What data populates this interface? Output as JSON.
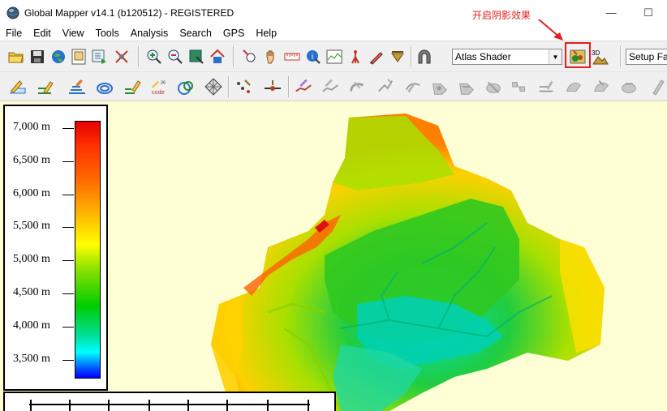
{
  "window": {
    "title": "Global Mapper v14.1 (b120512) - REGISTERED",
    "minimize": "—",
    "maximize": "☐"
  },
  "menu": [
    "File",
    "Edit",
    "View",
    "Tools",
    "Analysis",
    "Search",
    "GPS",
    "Help"
  ],
  "annotation": {
    "text": "开启阴影效果",
    "color": "#e02020"
  },
  "toolbar": {
    "shader": "Atlas Shader",
    "setup_favorites": "Setup Fav"
  },
  "legend": {
    "labels": [
      "7,000 m",
      "6,500 m",
      "6,000 m",
      "5,500 m",
      "5,000 m",
      "4,500 m",
      "4,000 m",
      "3,500 m"
    ]
  },
  "colors": {
    "map_background": "#ffffd6",
    "highlight": "#e02020"
  }
}
